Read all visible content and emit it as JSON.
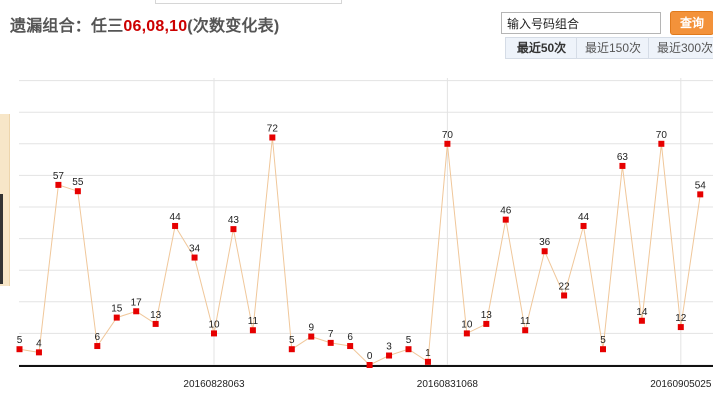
{
  "header": {
    "title_prefix": "遗漏组合：任三",
    "title_numbers": "06,08,10",
    "title_suffix": "(次数变化表)",
    "search_placeholder": "输入号码组合",
    "search_value": "输入号码组合",
    "query_label": "查询",
    "ranges": [
      {
        "label": "最近50次",
        "active": true
      },
      {
        "label": "最近150次",
        "active": false
      },
      {
        "label": "最近300次",
        "active": false
      }
    ]
  },
  "colors": {
    "accent": "#f3923a",
    "highlight": "#cc0000",
    "point": "#e60000",
    "line": "#f0c79a"
  },
  "chart_data": {
    "type": "line",
    "title": "",
    "xlabel": "",
    "ylabel": "",
    "ylim": [
      0,
      90
    ],
    "grid": true,
    "series": [
      {
        "values": [
          5,
          4,
          57,
          55,
          6,
          15,
          17,
          13,
          44,
          34,
          10,
          43,
          11,
          72,
          5,
          9,
          7,
          6,
          0,
          3,
          5,
          1,
          70,
          10,
          13,
          46,
          11,
          36,
          22,
          44,
          5,
          63,
          14,
          70,
          12,
          54
        ]
      }
    ],
    "x_tick_labels": [
      {
        "index": 10,
        "label": "20160828063"
      },
      {
        "index": 22,
        "label": "20160831068"
      },
      {
        "index": 34,
        "label": "20160905025"
      }
    ]
  }
}
